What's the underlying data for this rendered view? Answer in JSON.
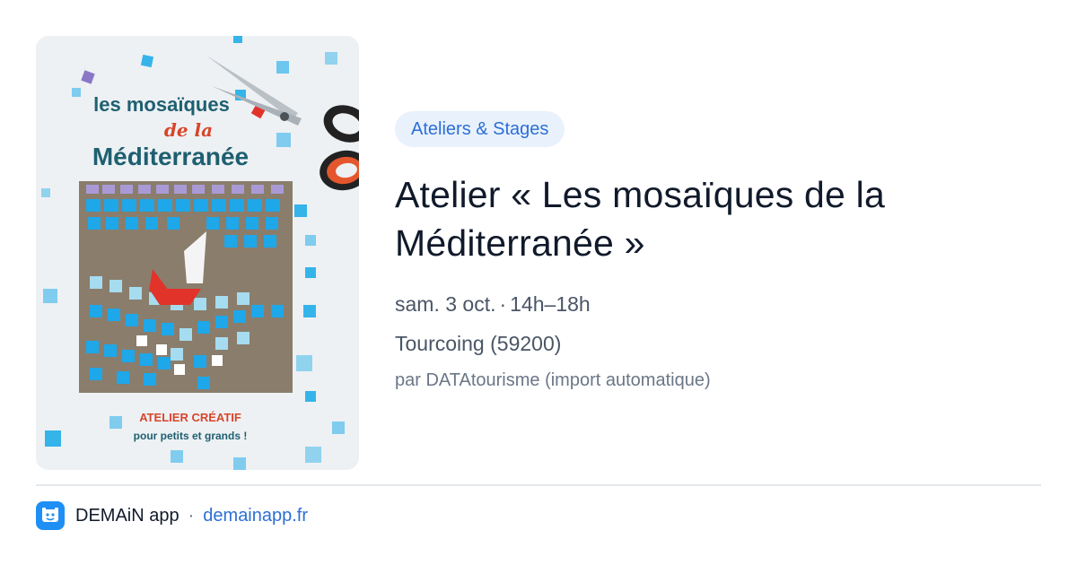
{
  "image": {
    "title_line1": "les mosaïques",
    "title_line2": "de la",
    "title_line3": "Méditerranée",
    "tagline1": "ATELIER CRÉATIF",
    "tagline2": "pour petits et grands !"
  },
  "event": {
    "category": "Ateliers & Stages",
    "title": "Atelier « Les mosaïques de la Méditerranée »",
    "date": "sam. 3 oct.",
    "time": "14h–18h",
    "location": "Tourcoing (59200)",
    "source": "par DATAtourisme (import automatique)"
  },
  "footer": {
    "app_icon": "app-logo-icon",
    "app_name": "DEMAiN app",
    "separator": "·",
    "domain": "demainapp.fr"
  },
  "colors": {
    "accent": "#2c6fd6",
    "category_bg": "#e9f1fc",
    "mosaic_blue": "#1aa3e8",
    "title_teal": "#1e5f70",
    "title_red": "#d8452a"
  }
}
